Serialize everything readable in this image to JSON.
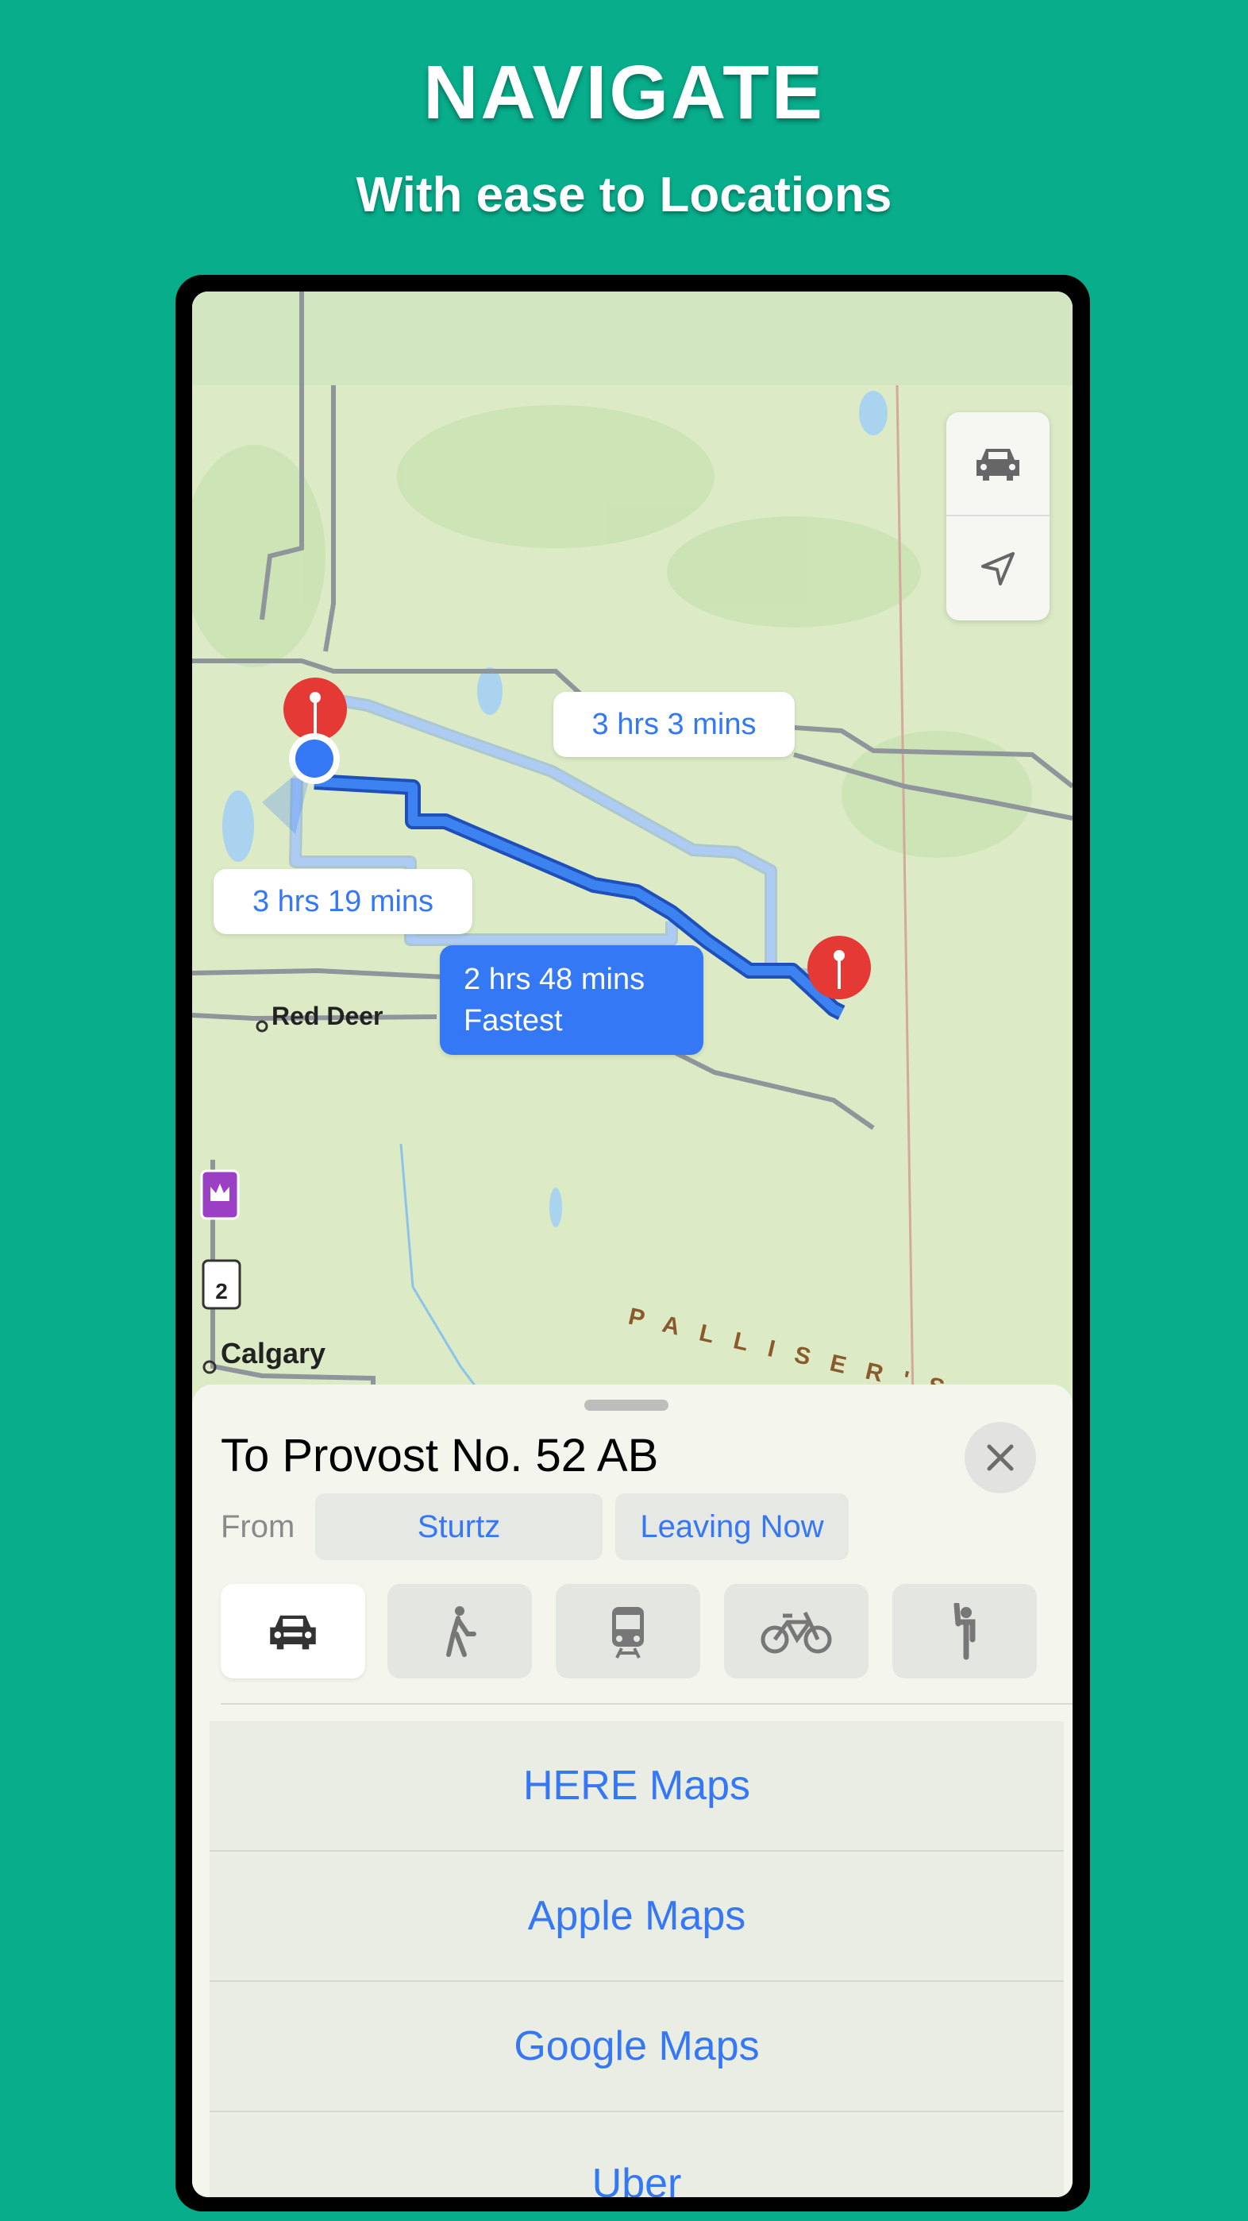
{
  "hero": {
    "title": "NAVIGATE",
    "subtitle": "With ease to Locations"
  },
  "map": {
    "routes": [
      {
        "time": "3 hrs 3 mins"
      },
      {
        "time": "3 hrs 19 mins"
      },
      {
        "time": "2 hrs 48 mins",
        "tag": "Fastest",
        "selected": true
      }
    ],
    "places": [
      "Red Deer",
      "Calgary"
    ],
    "region_label": "PALLISER'S",
    "highway_shield": "2",
    "controls": [
      "car-icon",
      "location-arrow-icon"
    ]
  },
  "sheet": {
    "title": "To Provost No. 52 AB",
    "from_label": "From",
    "from_value": "Sturtz",
    "time_value": "Leaving Now",
    "modes": [
      {
        "icon": "car-icon",
        "active": true
      },
      {
        "icon": "walk-icon"
      },
      {
        "icon": "transit-icon"
      },
      {
        "icon": "bicycle-icon"
      },
      {
        "icon": "ride-hail-icon"
      }
    ]
  },
  "apps": [
    "HERE Maps",
    "Apple Maps",
    "Google Maps",
    "Uber"
  ],
  "colors": {
    "background": "#08ad8b",
    "accent": "#3478f6",
    "pin": "#e53935"
  }
}
